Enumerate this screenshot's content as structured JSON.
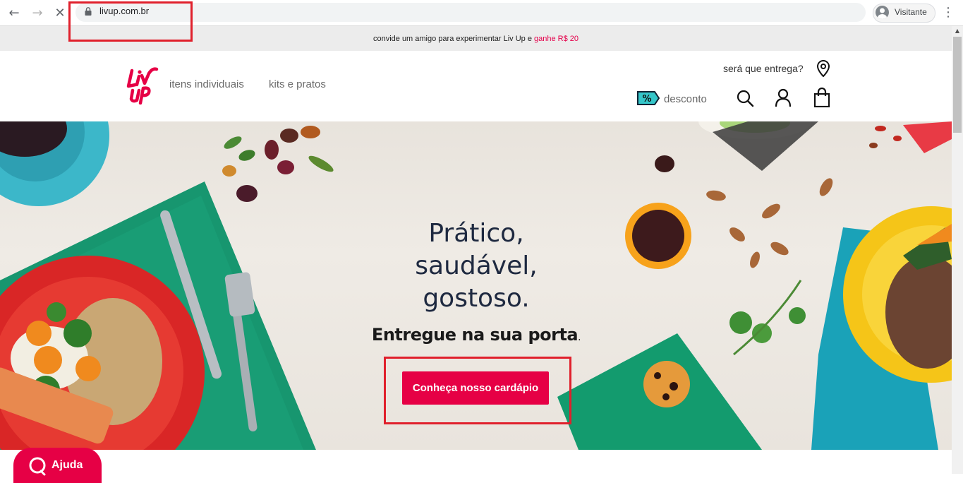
{
  "browser": {
    "url": "livup.com.br",
    "profile_label": "Visitante",
    "icons": [
      "back-arrow-icon",
      "forward-arrow-icon",
      "stop-loading-icon",
      "lock-icon",
      "profile-icon",
      "more-menu-icon"
    ]
  },
  "promo_bar": {
    "text": "convide um amigo para experimentar Liv Up e ",
    "highlight": "ganhe R$ 20",
    "highlight_color": "#e5004b"
  },
  "header": {
    "logo_text": "Liv Up",
    "nav": [
      {
        "label": "itens individuais"
      },
      {
        "label": "kits e pratos"
      }
    ],
    "delivery_label": "será que entrega?",
    "discount_label": "desconto",
    "icons": [
      "location-pin-icon",
      "discount-tag-icon",
      "search-icon",
      "user-icon",
      "shopping-bag-icon"
    ]
  },
  "hero": {
    "headline_lines": [
      "Prático,",
      "saudável,",
      "gostoso."
    ],
    "subline": "Entregue na sua porta",
    "subline_suffix": ".",
    "cta_label": "Conheça nosso cardápio",
    "cta_color": "#e60045"
  },
  "help": {
    "label": "Ajuda",
    "icon": "chat-bubble-icon"
  },
  "colors": {
    "brand": "#e60045",
    "text_dark": "#1e2940",
    "annotation": "#e0202c"
  }
}
